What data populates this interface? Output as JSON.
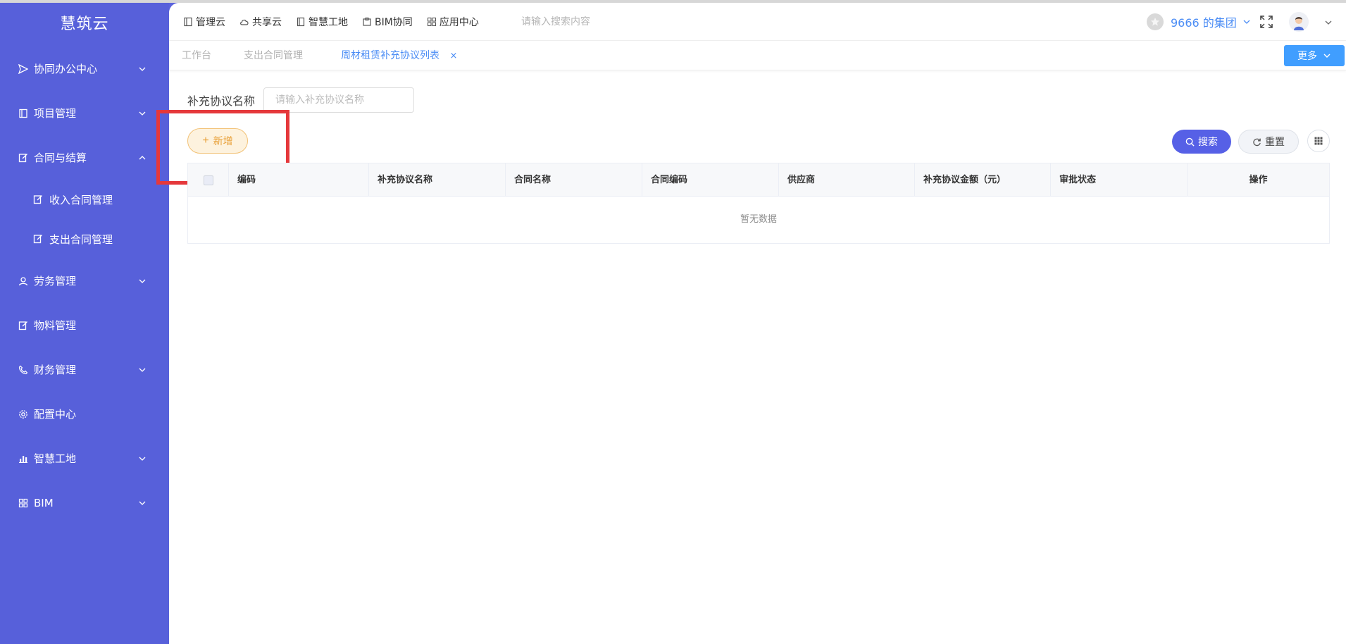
{
  "app": {
    "logo_text": "慧筑云"
  },
  "sidebar": {
    "items": [
      {
        "label": "协同办公中心",
        "icon": "send-icon",
        "arrow": "down"
      },
      {
        "label": "项目管理",
        "icon": "book-icon",
        "arrow": "down"
      },
      {
        "label": "合同与结算",
        "icon": "edit-icon",
        "arrow": "up",
        "children": [
          {
            "label": "收入合同管理",
            "icon": "edit-icon"
          },
          {
            "label": "支出合同管理",
            "icon": "edit-icon"
          }
        ]
      },
      {
        "label": "劳务管理",
        "icon": "user-icon",
        "arrow": "down"
      },
      {
        "label": "物料管理",
        "icon": "edit-icon",
        "arrow": ""
      },
      {
        "label": "财务管理",
        "icon": "phone-icon",
        "arrow": "down"
      },
      {
        "label": "配置中心",
        "icon": "gear-icon",
        "arrow": ""
      },
      {
        "label": "智慧工地",
        "icon": "bar-chart-icon",
        "arrow": "down"
      },
      {
        "label": "BIM",
        "icon": "grid-icon",
        "arrow": "down"
      }
    ]
  },
  "header": {
    "nav": [
      {
        "label": "管理云",
        "icon": "panel-icon"
      },
      {
        "label": "共享云",
        "icon": "cloud-icon"
      },
      {
        "label": "智慧工地",
        "icon": "book-icon"
      },
      {
        "label": "BIM协同",
        "icon": "box-icon"
      },
      {
        "label": "应用中心",
        "icon": "grid-icon"
      }
    ],
    "search_placeholder": "请输入搜索内容",
    "group_name": "9666 的集团"
  },
  "tabs": {
    "items": [
      {
        "label": "工作台",
        "active": false
      },
      {
        "label": "支出合同管理",
        "active": false
      },
      {
        "label": "周材租赁补充协议列表",
        "active": true
      }
    ],
    "close_symbol": "×",
    "more_label": "更多"
  },
  "filter": {
    "label": "补充协议名称",
    "placeholder": "请输入补充协议名称"
  },
  "toolbar": {
    "add_label": "新增",
    "search_label": "搜索",
    "reset_label": "重置"
  },
  "table": {
    "columns": [
      "编码",
      "补充协议名称",
      "合同名称",
      "合同编码",
      "供应商",
      "补充协议金额（元）",
      "审批状态",
      "操作"
    ],
    "rows": [],
    "empty_text": "暂无数据"
  },
  "colors": {
    "sidebar_bg": "#5760da",
    "accent_blue": "#409eff",
    "primary_button": "#5660e6",
    "add_button_text": "#e8a038",
    "highlight": "#e5383b"
  }
}
